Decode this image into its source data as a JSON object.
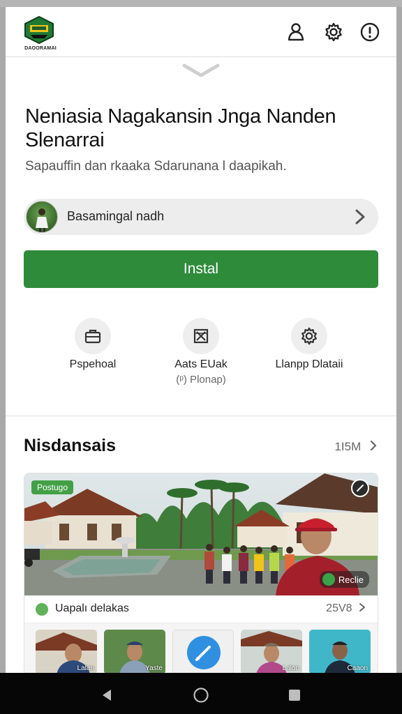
{
  "header": {
    "logo_text": "DAOORAMAI",
    "icons": [
      "person-icon",
      "gear-icon",
      "info-icon"
    ]
  },
  "app": {
    "title": "Neniasia Nagakansin Jnga Nanden Slenarrai",
    "subtitle": "Sapauffin dan rkaaka Sdarunana l daapikah.",
    "developer": "Basamingal nadh",
    "install_label": "Instal"
  },
  "features": [
    {
      "label": "Pspehoal",
      "sub": "",
      "icon": "briefcase-icon"
    },
    {
      "label": "Aats EUak",
      "sub": "(ᵖ) Plonap)",
      "icon": "box-x-icon"
    },
    {
      "label": "Llanpp Dlataii",
      "sub": "",
      "icon": "gear-icon"
    }
  ],
  "section": {
    "title": "Nisdansais",
    "meta": "1I5M"
  },
  "card": {
    "badge": "Postugo",
    "tag": "Reclie",
    "info_text": "Uapalı delakas",
    "info_meta": "25V8",
    "thumb_captions": [
      "Lalan",
      "Yaste",
      "",
      "Lalon",
      "Caaon"
    ]
  },
  "colors": {
    "primary": "#2e8b3a",
    "badge": "#43a047",
    "navbar": "#060606"
  }
}
